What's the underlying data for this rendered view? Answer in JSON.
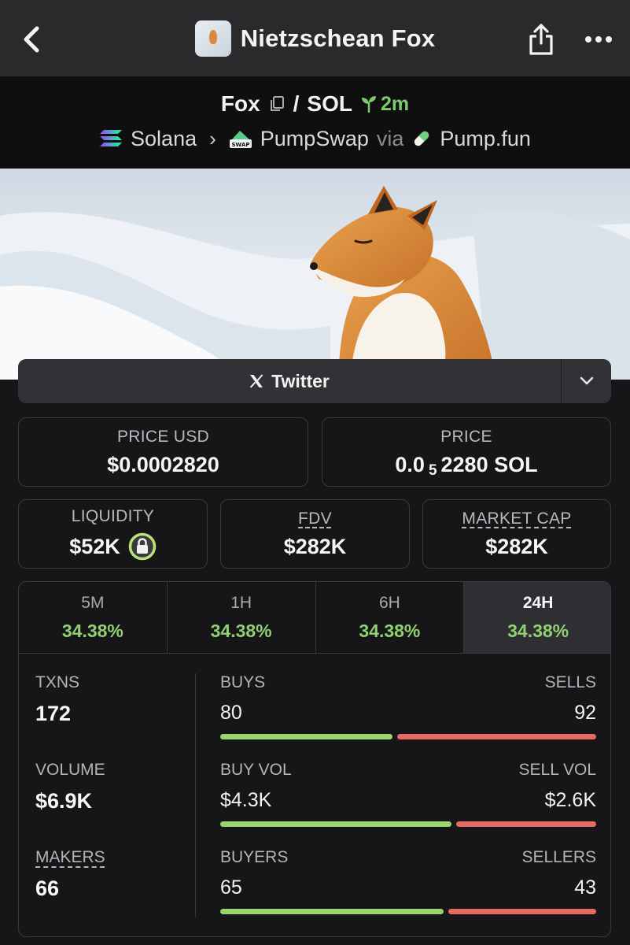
{
  "app": {
    "title": "Nietzschean Fox"
  },
  "pair": {
    "base": "Fox",
    "separator": "/",
    "quote": "SOL",
    "age": "2m",
    "chain": "Solana",
    "dex": "PumpSwap",
    "via_label": "via",
    "launchpad": "Pump.fun"
  },
  "links": {
    "twitter_label": "Twitter"
  },
  "prices": {
    "price_usd_label": "PRICE USD",
    "price_usd": "$0.0002820",
    "price_label": "PRICE",
    "price_prefix": "0.0",
    "price_zero_count": "5",
    "price_suffix": "2280 SOL"
  },
  "metrics": {
    "liquidity_label": "LIQUIDITY",
    "liquidity": "$52K",
    "fdv_label": "FDV",
    "fdv": "$282K",
    "mcap_label": "MARKET CAP",
    "mcap": "$282K"
  },
  "timeframes": [
    {
      "label": "5M",
      "change": "34.38%"
    },
    {
      "label": "1H",
      "change": "34.38%"
    },
    {
      "label": "6H",
      "change": "34.38%"
    },
    {
      "label": "24H",
      "change": "34.38%"
    }
  ],
  "active_timeframe": "24H",
  "stats": {
    "txns_label": "TXNS",
    "txns": "172",
    "volume_label": "VOLUME",
    "volume": "$6.9K",
    "makers_label": "MAKERS",
    "makers": "66"
  },
  "splits": [
    {
      "left_label": "BUYS",
      "left_value": "80",
      "right_label": "SELLS",
      "right_value": "92",
      "buy_fraction": 0.465
    },
    {
      "left_label": "BUY VOL",
      "left_value": "$4.3K",
      "right_label": "SELL VOL",
      "right_value": "$2.6K",
      "buy_fraction": 0.623
    },
    {
      "left_label": "BUYERS",
      "left_value": "65",
      "right_label": "SELLERS",
      "right_value": "43",
      "buy_fraction": 0.602
    }
  ],
  "colors": {
    "positive": "#8fd16f",
    "buy_bar": "#9bd46a",
    "sell_bar": "#e46a63",
    "lock_ring": "#b9e27a"
  }
}
